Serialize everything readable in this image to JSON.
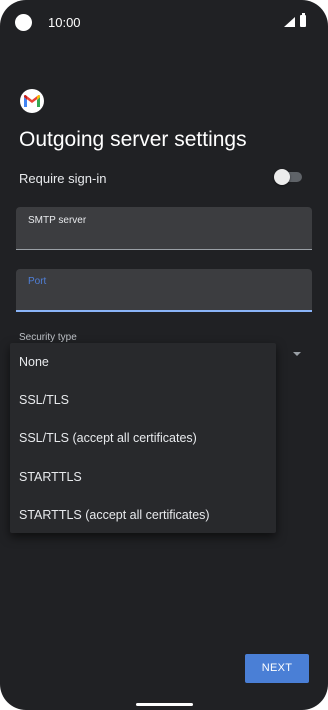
{
  "status_bar": {
    "time": "10:00",
    "icons": [
      "camera-icon",
      "signal-icon",
      "battery-icon"
    ]
  },
  "app": {
    "logo_icon": "gmail-icon",
    "title": "Outgoing server settings"
  },
  "form": {
    "require_signin": {
      "label": "Require sign-in",
      "enabled": false
    },
    "smtp_server": {
      "label": "SMTP server",
      "value": ""
    },
    "port": {
      "label": "Port",
      "value": "",
      "focused": true
    },
    "security_type": {
      "label": "Security type",
      "options": [
        "None",
        "SSL/TLS",
        "SSL/TLS (accept all certificates)",
        "STARTTLS",
        "STARTTLS (accept all certificates)"
      ]
    }
  },
  "actions": {
    "next_label": "NEXT"
  },
  "colors": {
    "background": "#202124",
    "accent": "#4a7fd6",
    "focused_underline": "#8ab4f8"
  }
}
